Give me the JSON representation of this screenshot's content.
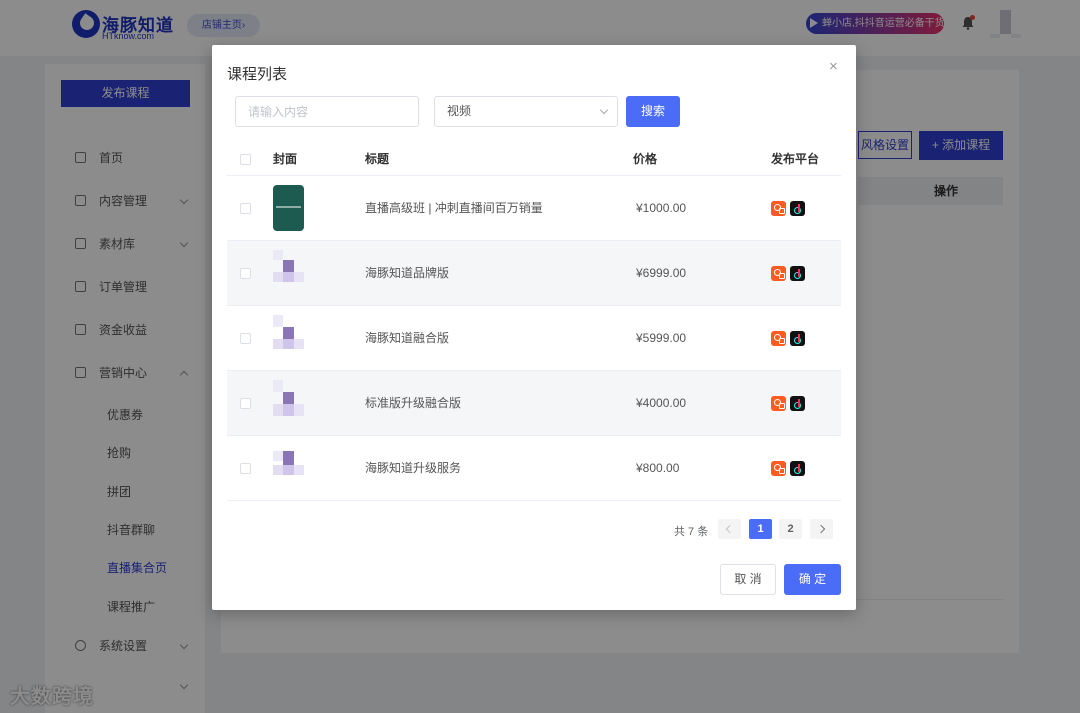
{
  "header": {
    "logo_title": "海豚知道",
    "logo_sub": "HTknow.com",
    "shop_home": "店铺主页›",
    "promo": "蝉小店,抖抖音运营必备干货"
  },
  "sidebar": {
    "publish_button": "发布课程",
    "items": [
      {
        "label": "首页"
      },
      {
        "label": "内容管理"
      },
      {
        "label": "素材库"
      },
      {
        "label": "订单管理"
      },
      {
        "label": "资金收益"
      },
      {
        "label": "营销中心"
      },
      {
        "label": "系统设置"
      }
    ],
    "sub_items": [
      {
        "label": "优惠券"
      },
      {
        "label": "抢购"
      },
      {
        "label": "拼团"
      },
      {
        "label": "抖音群聊"
      },
      {
        "label": "直播集合页"
      },
      {
        "label": "课程推广"
      }
    ]
  },
  "content": {
    "style_button": "风格设置",
    "add_button": "+ 添加课程",
    "op_header": "操作"
  },
  "watermark": "大数跨境",
  "modal": {
    "title": "课程列表",
    "close": "×",
    "search_placeholder": "请输入内容",
    "select_value": "视频",
    "search_button": "搜索",
    "columns": {
      "cover": "封面",
      "title": "标题",
      "price": "价格",
      "platform": "发布平台"
    },
    "rows": [
      {
        "title": "直播高级班 | 冲刺直播间百万销量",
        "price": "¥1000.00",
        "cover": "green"
      },
      {
        "title": "海豚知道品牌版",
        "price": "¥6999.00",
        "cover": "mosaic"
      },
      {
        "title": "海豚知道融合版",
        "price": "¥5999.00",
        "cover": "mosaic"
      },
      {
        "title": "标准版升级融合版",
        "price": "¥4000.00",
        "cover": "mosaic"
      },
      {
        "title": "海豚知道升级服务",
        "price": "¥800.00",
        "cover": "mosaic"
      }
    ],
    "platforms": [
      "kuaishou-icon",
      "douyin-icon"
    ],
    "pagination": {
      "total": "共 7 条",
      "pages": [
        "1",
        "2"
      ],
      "current": "1"
    },
    "cancel_button": "取 消",
    "ok_button": "确 定"
  },
  "colors": {
    "primary": "#4a6cf7",
    "brand": "#1f33c4",
    "kuaishou": "#ff5a1f",
    "douyin": "#111111"
  }
}
